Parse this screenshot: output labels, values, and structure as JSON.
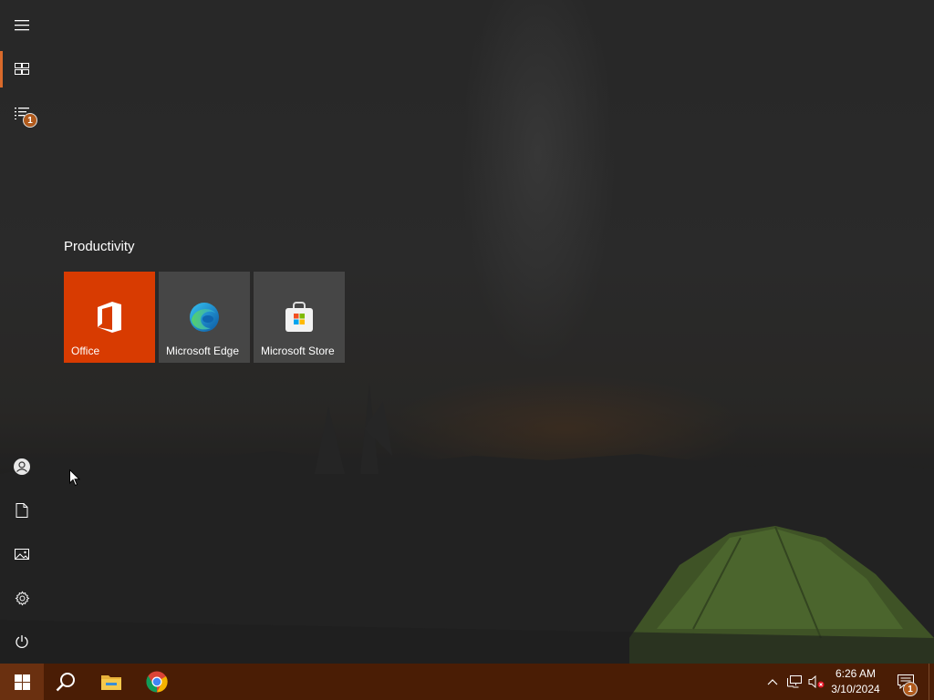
{
  "colors": {
    "accent": "#d96a2b",
    "taskbar": "#4a1d05",
    "office_tile": "#d83b01",
    "tent_green": "#6c9a3a"
  },
  "start_menu": {
    "rail": [
      {
        "name": "hamburger-menu",
        "icon": "menu-icon"
      },
      {
        "name": "tiles-view",
        "icon": "tiles-icon",
        "active": true
      },
      {
        "name": "all-apps-list",
        "icon": "list-icon",
        "badge": "1"
      },
      {
        "name": "user-account",
        "icon": "user-icon"
      },
      {
        "name": "documents",
        "icon": "document-icon"
      },
      {
        "name": "pictures",
        "icon": "pictures-icon"
      },
      {
        "name": "settings",
        "icon": "gear-icon"
      },
      {
        "name": "power",
        "icon": "power-icon"
      }
    ],
    "group_title": "Productivity",
    "tiles": [
      {
        "label": "Office",
        "icon": "office-icon"
      },
      {
        "label": "Microsoft Edge",
        "icon": "edge-icon"
      },
      {
        "label": "Microsoft Store",
        "icon": "store-icon"
      }
    ]
  },
  "taskbar": {
    "apps": [
      {
        "name": "start",
        "icon": "windows-icon"
      },
      {
        "name": "search",
        "icon": "search-icon"
      },
      {
        "name": "file-explorer",
        "icon": "folder-icon"
      },
      {
        "name": "chrome",
        "icon": "chrome-icon"
      }
    ],
    "tray": {
      "time": "6:26 AM",
      "date": "3/10/2024",
      "notification_count": "1"
    }
  }
}
